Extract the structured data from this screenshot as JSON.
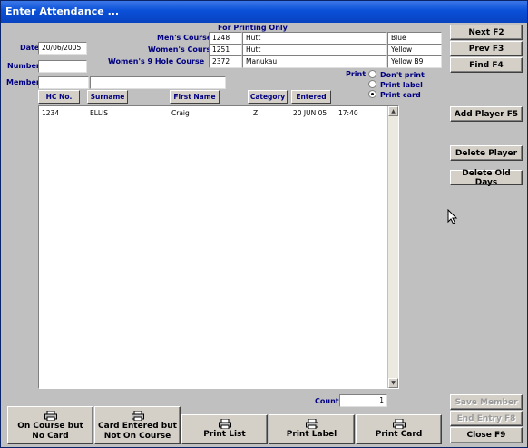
{
  "window": {
    "title": "Enter Attendance ..."
  },
  "printing": {
    "heading": "For Printing Only",
    "rows": [
      {
        "label": "Men's Course",
        "code": "1248",
        "course": "Hutt",
        "tee": "Blue"
      },
      {
        "label": "Women's Course",
        "code": "1251",
        "course": "Hutt",
        "tee": "Yellow"
      },
      {
        "label": "Women's 9 Hole Course",
        "code": "2372",
        "course": "Manukau",
        "tee": "Yellow B9"
      }
    ]
  },
  "form": {
    "date_label": "Date",
    "date_value": "20/06/2005",
    "number_label": "Number",
    "number_value": "",
    "member_label": "Member",
    "member_value": "",
    "member_name": ""
  },
  "print_options": {
    "label": "Print",
    "options": [
      "Don't print",
      "Print label",
      "Print card"
    ],
    "selected": "Print card"
  },
  "table": {
    "headers": [
      "HC No.",
      "Surname",
      "First Name",
      "Category",
      "Entered"
    ],
    "rows": [
      {
        "hc": "1234",
        "surname": "ELLIS",
        "first": "Craig",
        "category": "Z",
        "date": "20 JUN 05",
        "time": "17:40"
      }
    ]
  },
  "count": {
    "label": "Count",
    "value": "1"
  },
  "side_buttons": {
    "next": "Next F2",
    "prev": "Prev F3",
    "find": "Find F4",
    "add_player": "Add Player F5",
    "delete_player": "Delete Player",
    "delete_old_days": "Delete Old Days",
    "save_member": "Save Member",
    "end_entry": "End Entry F8",
    "close": "Close F9"
  },
  "bottom_buttons": {
    "on_course": "On Course but No Card",
    "card_entered": "Card Entered but Not On Course",
    "print_list": "Print List",
    "print_label": "Print Label",
    "print_card": "Print Card"
  }
}
